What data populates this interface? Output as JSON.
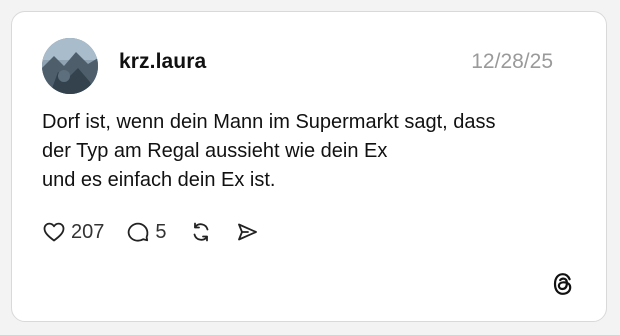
{
  "post": {
    "username": "krz.laura",
    "date": "12/28/25",
    "text_lines": [
      "Dorf ist, wenn dein Mann im Supermarkt sagt, dass",
      "der Typ am Regal aussieht wie dein Ex",
      "und es einfach dein Ex ist."
    ],
    "likes": "207",
    "replies": "5"
  },
  "icons": {
    "like": "heart-icon",
    "reply": "comment-bubble-icon",
    "repost": "repost-icon",
    "share": "send-icon",
    "brand": "threads-logo-icon"
  },
  "colors": {
    "text": "#111111",
    "muted": "#9a9a9a",
    "border": "#d9d9d9"
  }
}
